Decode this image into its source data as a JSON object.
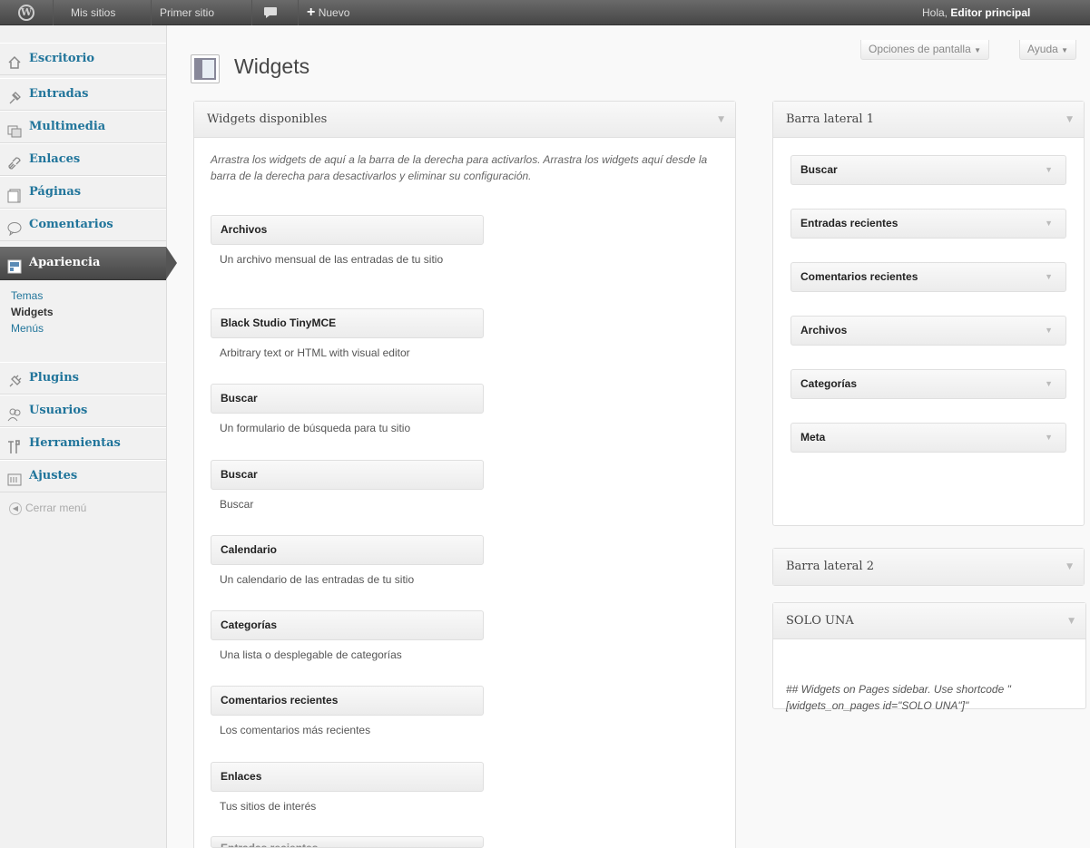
{
  "adminbar": {
    "mis_sitios": "Mis sitios",
    "primer_sitio": "Primer sitio",
    "comment_icon": "comment-bubble-icon",
    "nuevo": "Nuevo",
    "greeting": "Hola,",
    "user": "Editor principal"
  },
  "menu": {
    "items": [
      {
        "label": "Escritorio",
        "icon": "dashboard-icon"
      },
      {
        "label": "Entradas",
        "icon": "pushpin-icon"
      },
      {
        "label": "Multimedia",
        "icon": "media-icon"
      },
      {
        "label": "Enlaces",
        "icon": "link-icon"
      },
      {
        "label": "Páginas",
        "icon": "page-icon"
      },
      {
        "label": "Comentarios",
        "icon": "comment-icon"
      },
      {
        "label": "Apariencia",
        "icon": "appearance-icon"
      },
      {
        "label": "Plugins",
        "icon": "plugin-icon"
      },
      {
        "label": "Usuarios",
        "icon": "users-icon"
      },
      {
        "label": "Herramientas",
        "icon": "tools-icon"
      },
      {
        "label": "Ajustes",
        "icon": "settings-icon"
      }
    ],
    "submenu": [
      "Temas",
      "Widgets",
      "Menús"
    ],
    "collapse": "Cerrar menú"
  },
  "screen_meta": {
    "options": "Opciones de pantalla",
    "help": "Ayuda"
  },
  "page": {
    "title": "Widgets"
  },
  "available": {
    "title": "Widgets disponibles",
    "description": "Arrastra los widgets de aquí a la barra de la derecha para activarlos. Arrastra los widgets aquí desde la barra de la derecha para desactivarlos y eliminar su configuración.",
    "widgets": [
      {
        "name": "Archivos",
        "desc": "Un archivo mensual de las entradas de tu sitio"
      },
      {
        "name": "Black Studio TinyMCE",
        "desc": "Arbitrary text or HTML with visual editor"
      },
      {
        "name": "Buscar",
        "desc": "Un formulario de búsqueda para tu sitio"
      },
      {
        "name": "Buscar",
        "desc": "Buscar"
      },
      {
        "name": "Calendario",
        "desc": "Un calendario de las entradas de tu sitio"
      },
      {
        "name": "Categorías",
        "desc": "Una lista o desplegable de categorías"
      },
      {
        "name": "Comentarios recientes",
        "desc": "Los comentarios más recientes"
      },
      {
        "name": "Enlaces",
        "desc": "Tus sitios de interés"
      },
      {
        "name": "Entradas recientes",
        "desc": ""
      }
    ]
  },
  "sidebar1": {
    "title": "Barra lateral 1",
    "widgets": [
      "Buscar",
      "Entradas recientes",
      "Comentarios recientes",
      "Archivos",
      "Categorías",
      "Meta"
    ]
  },
  "sidebar2": {
    "title": "Barra lateral 2"
  },
  "solo": {
    "title": "SOLO UNA",
    "desc": "## Widgets on Pages sidebar. Use shortcode \"[widgets_on_pages id=\"SOLO UNA\"]\""
  }
}
